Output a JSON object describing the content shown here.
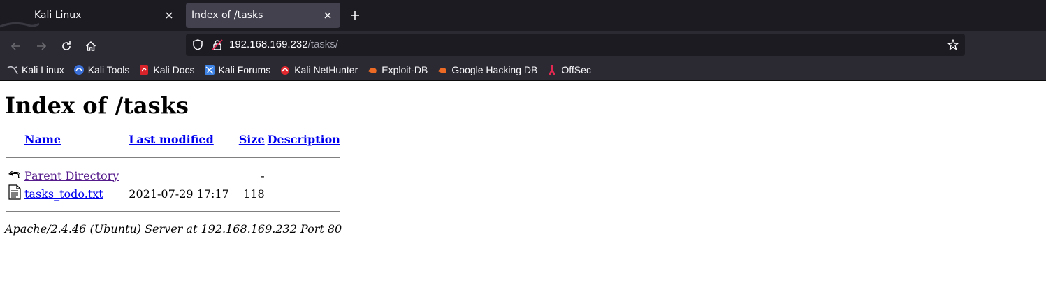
{
  "browser": {
    "tabs": [
      {
        "title": "Kali Linux",
        "active": false
      },
      {
        "title": "Index of /tasks",
        "active": true
      }
    ],
    "url": {
      "host": "192.168.169.232",
      "path": "/tasks/"
    },
    "bookmarks": [
      {
        "label": "Kali Linux",
        "icon": "kali-dragon-icon"
      },
      {
        "label": "Kali Tools",
        "icon": "kali-tools-icon"
      },
      {
        "label": "Kali Docs",
        "icon": "kali-docs-icon"
      },
      {
        "label": "Kali Forums",
        "icon": "kali-forums-icon"
      },
      {
        "label": "Kali NetHunter",
        "icon": "kali-nethunter-icon"
      },
      {
        "label": "Exploit-DB",
        "icon": "exploit-db-icon"
      },
      {
        "label": "Google Hacking DB",
        "icon": "ghdb-icon"
      },
      {
        "label": "OffSec",
        "icon": "offsec-icon"
      }
    ]
  },
  "page": {
    "heading": "Index of /tasks",
    "columns": {
      "name": "Name",
      "modified": "Last modified",
      "size": "Size",
      "description": "Description"
    },
    "rows": [
      {
        "name": "Parent Directory",
        "modified": "",
        "size": "-",
        "description": "",
        "icon": "back-arrow-icon"
      },
      {
        "name": "tasks_todo.txt",
        "modified": "2021-07-29 17:17",
        "size": "118",
        "description": "",
        "icon": "text-file-icon"
      }
    ],
    "footer": "Apache/2.4.46 (Ubuntu) Server at 192.168.169.232 Port 80"
  }
}
